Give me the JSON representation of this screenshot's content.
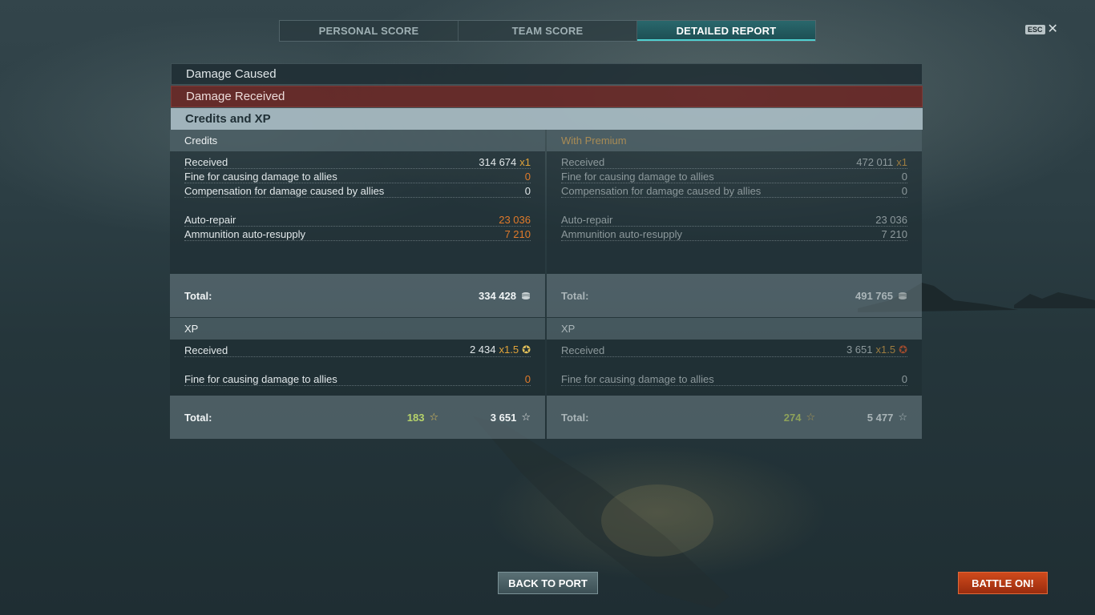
{
  "tabs": [
    {
      "label": "PERSONAL SCORE",
      "active": false
    },
    {
      "label": "TEAM SCORE",
      "active": false
    },
    {
      "label": "DETAILED REPORT",
      "active": true
    }
  ],
  "esc": {
    "key": "ESC",
    "icon": "close-icon"
  },
  "sections": {
    "damage_caused": "Damage Caused",
    "damage_received": "Damage Received",
    "credits_xp": "Credits and XP"
  },
  "credits": {
    "header": "Credits",
    "received_label": "Received",
    "received_value": "314 674",
    "received_mult": "x1",
    "fine_label": "Fine for causing damage to allies",
    "fine_value": "0",
    "compensation_label": "Compensation for damage caused by allies",
    "compensation_value": "0",
    "autorepair_label": "Auto-repair",
    "autorepair_value": "23 036",
    "ammo_label": "Ammunition auto-resupply",
    "ammo_value": "7 210",
    "total_label": "Total:",
    "total_value": "334 428",
    "total_icon": "credits-icon"
  },
  "credits_premium": {
    "header": "With Premium",
    "received_label": "Received",
    "received_value": "472 011",
    "received_mult": "x1",
    "fine_label": "Fine for causing damage to allies",
    "fine_value": "0",
    "compensation_label": "Compensation for damage caused by allies",
    "compensation_value": "0",
    "autorepair_label": "Auto-repair",
    "autorepair_value": "23 036",
    "ammo_label": "Ammunition auto-resupply",
    "ammo_value": "7 210",
    "total_label": "Total:",
    "total_value": "491 765",
    "total_icon": "credits-icon"
  },
  "xp": {
    "header": "XP",
    "received_label": "Received",
    "received_value": "2 434",
    "received_mult": "x1.5",
    "fine_label": "Fine for causing damage to allies",
    "fine_value": "0",
    "total_label": "Total:",
    "free_xp_value": "183",
    "total_value": "3 651",
    "star_glyph": "☆"
  },
  "xp_premium": {
    "header": "XP",
    "received_label": "Received",
    "received_value": "3 651",
    "received_mult": "x1.5",
    "fine_label": "Fine for causing damage to allies",
    "fine_value": "0",
    "total_label": "Total:",
    "free_xp_value": "274",
    "total_value": "5 477",
    "star_glyph": "☆"
  },
  "buttons": {
    "back_to_port": "BACK TO PORT",
    "battle_on": "BATTLE ON!"
  },
  "colors": {
    "accent_teal": "#4fd0d0",
    "fine_orange": "#e07a2a",
    "free_xp_green": "#b6d36a",
    "battle_button": "#cf4a1c",
    "damage_received_bar": "#692826"
  }
}
